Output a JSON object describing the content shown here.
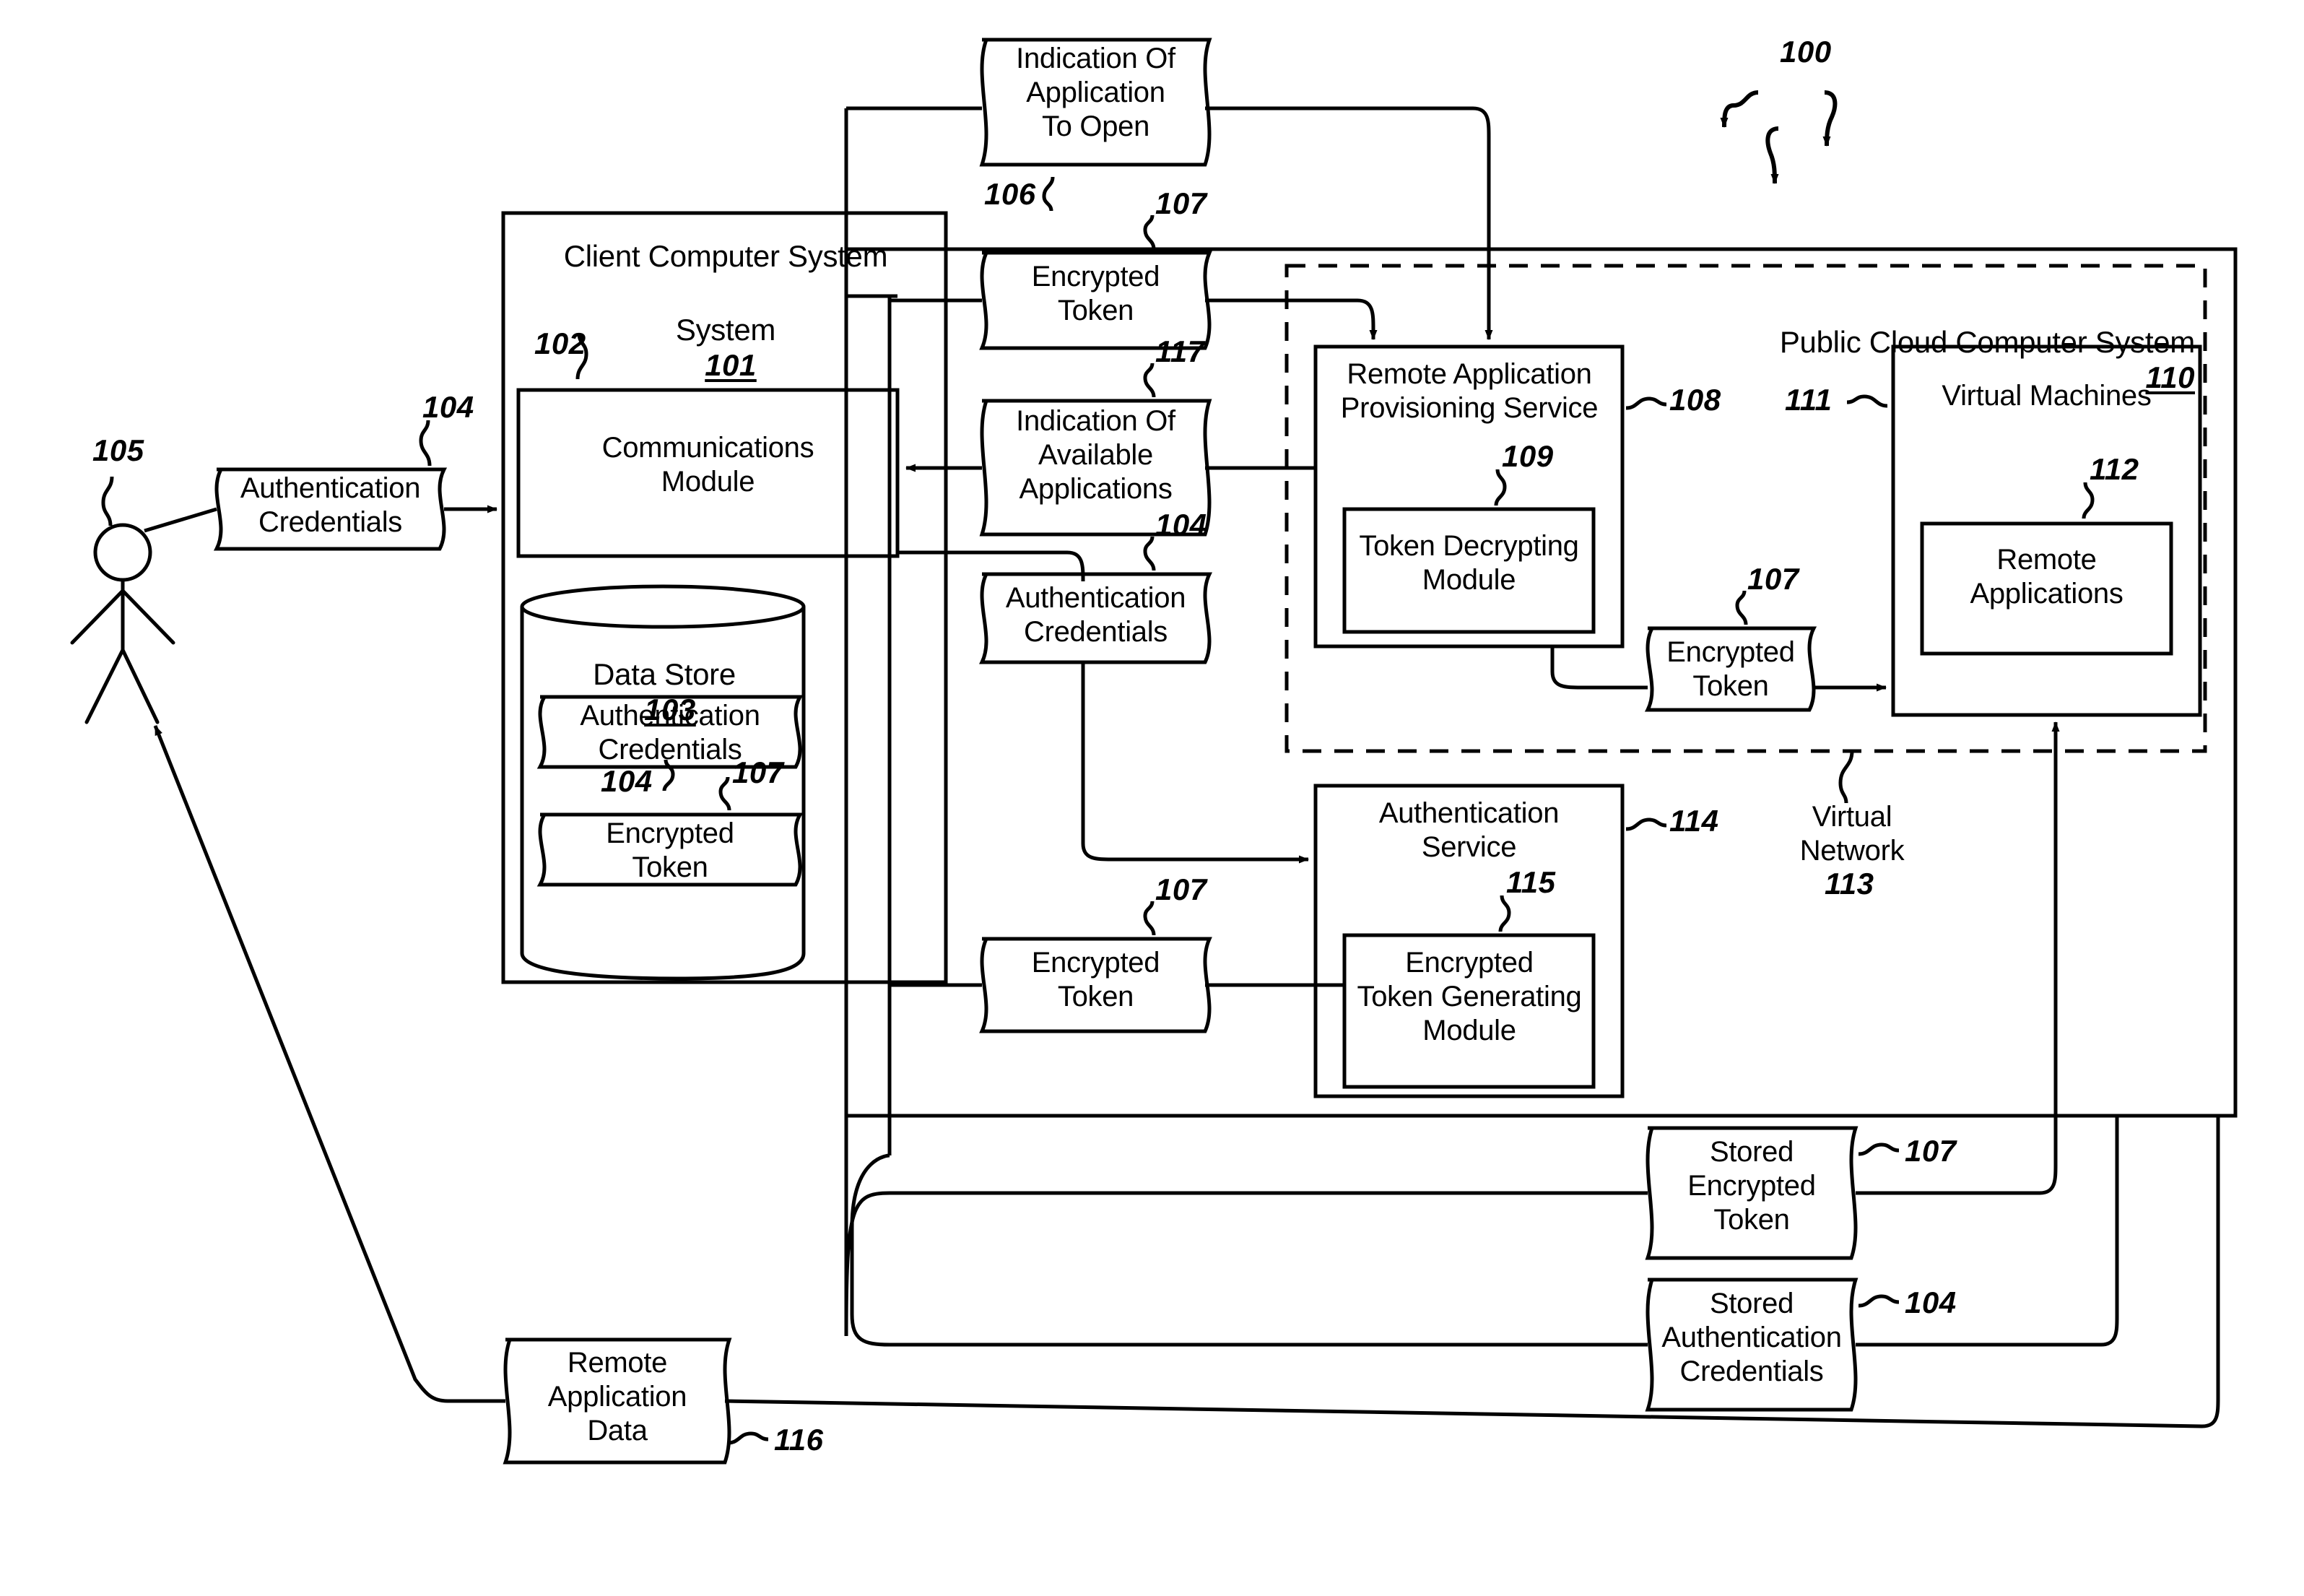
{
  "figure": {
    "figure_ref": "100",
    "background": "#ffffff",
    "line_color": "#000000"
  },
  "actor": {
    "name": "user-stick-figure",
    "ref": "105"
  },
  "client_system": {
    "title": "Client Computer System",
    "ref": "101",
    "communications_module": {
      "label": "Communications\nModule",
      "ref": "102"
    },
    "data_store": {
      "title": "Data Store",
      "ref": "103",
      "items": [
        {
          "label": "Authentication\nCredentials",
          "ref": "104"
        },
        {
          "label": "Encrypted\nToken",
          "ref": "107"
        }
      ]
    }
  },
  "cloud_system": {
    "title": "Public Cloud Computer System",
    "ref": "110",
    "virtual_network": {
      "label": "Virtual\nNetwork",
      "ref": "113"
    },
    "remote_application_provisioning_service": {
      "label": "Remote Application\nProvisioning Service",
      "ref": "108",
      "token_decrypting_module": {
        "label": "Token Decrypting\nModule",
        "ref": "109"
      }
    },
    "virtual_machines": {
      "label": "Virtual Machines",
      "ref": "111",
      "remote_applications": {
        "label": "Remote\nApplications",
        "ref": "112"
      }
    },
    "authentication_service": {
      "label": "Authentication\nService",
      "ref": "114",
      "encrypted_token_generating_module": {
        "label": "Encrypted\nToken Generating\nModule",
        "ref": "115"
      }
    }
  },
  "data_flows": [
    {
      "id": "auth-credentials-user",
      "label": "Authentication\nCredentials",
      "ref": "104"
    },
    {
      "id": "indication-application-to-open",
      "label": "Indication Of\nApplication\nTo Open",
      "ref": "106"
    },
    {
      "id": "encrypted-token-upper",
      "label": "Encrypted\nToken",
      "ref": "107"
    },
    {
      "id": "indication-available-applications",
      "label": "Indication Of\nAvailable\nApplications",
      "ref": "117"
    },
    {
      "id": "auth-credentials-mid",
      "label": "Authentication\nCredentials",
      "ref": "104"
    },
    {
      "id": "encrypted-token-lower",
      "label": "Encrypted\nToken",
      "ref": "107"
    },
    {
      "id": "encrypted-token-cloud",
      "label": "Encrypted\nToken",
      "ref": "107"
    },
    {
      "id": "stored-encrypted-token",
      "label": "Stored\nEncrypted\nToken",
      "ref": "107"
    },
    {
      "id": "stored-auth-credentials",
      "label": "Stored\nAuthentication\nCredentials",
      "ref": "104"
    },
    {
      "id": "remote-application-data",
      "label": "Remote\nApplication\nData",
      "ref": "116"
    }
  ]
}
